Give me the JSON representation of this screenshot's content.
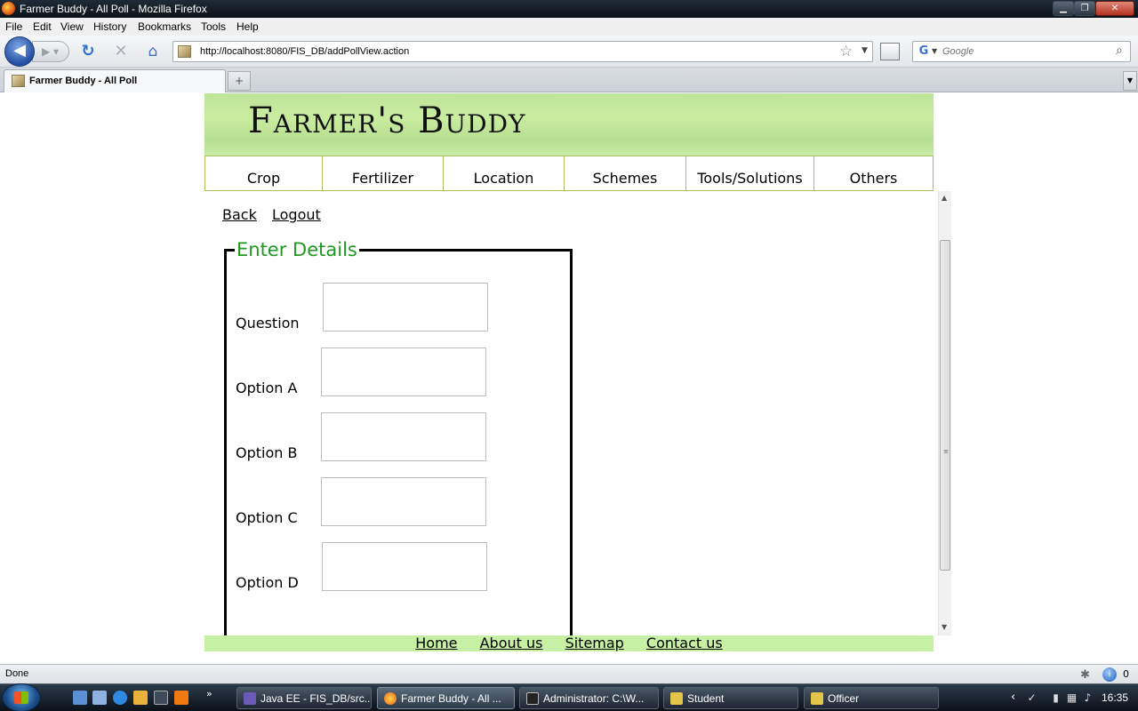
{
  "window": {
    "title": "Farmer Buddy - All Poll - Mozilla Firefox"
  },
  "menu": [
    "File",
    "Edit",
    "View",
    "History",
    "Bookmarks",
    "Tools",
    "Help"
  ],
  "toolbar": {
    "url": "http://localhost:8080/FIS_DB/addPollView.action",
    "search_placeholder": "Google"
  },
  "tab": {
    "label": "Farmer Buddy - All Poll"
  },
  "site": {
    "logo": "Farmer's Buddy",
    "nav": [
      "Crop",
      "Fertilizer",
      "Location",
      "Schemes",
      "Tools/Solutions",
      "Others"
    ],
    "links": {
      "back": "Back",
      "logout": "Logout"
    },
    "form": {
      "legend": "Enter Details",
      "fields": [
        "Question",
        "Option A",
        "Option B",
        "Option C",
        "Option D"
      ]
    },
    "footer": [
      "Home",
      "About us",
      "Sitemap",
      "Contact us"
    ]
  },
  "status": {
    "text": "Done",
    "count": "0"
  },
  "taskbar": {
    "tasks": [
      "Java EE - FIS_DB/src...",
      "Farmer Buddy - All ...",
      "Administrator: C:\\W...",
      "Student",
      "Officer"
    ],
    "clock": "16:35"
  }
}
